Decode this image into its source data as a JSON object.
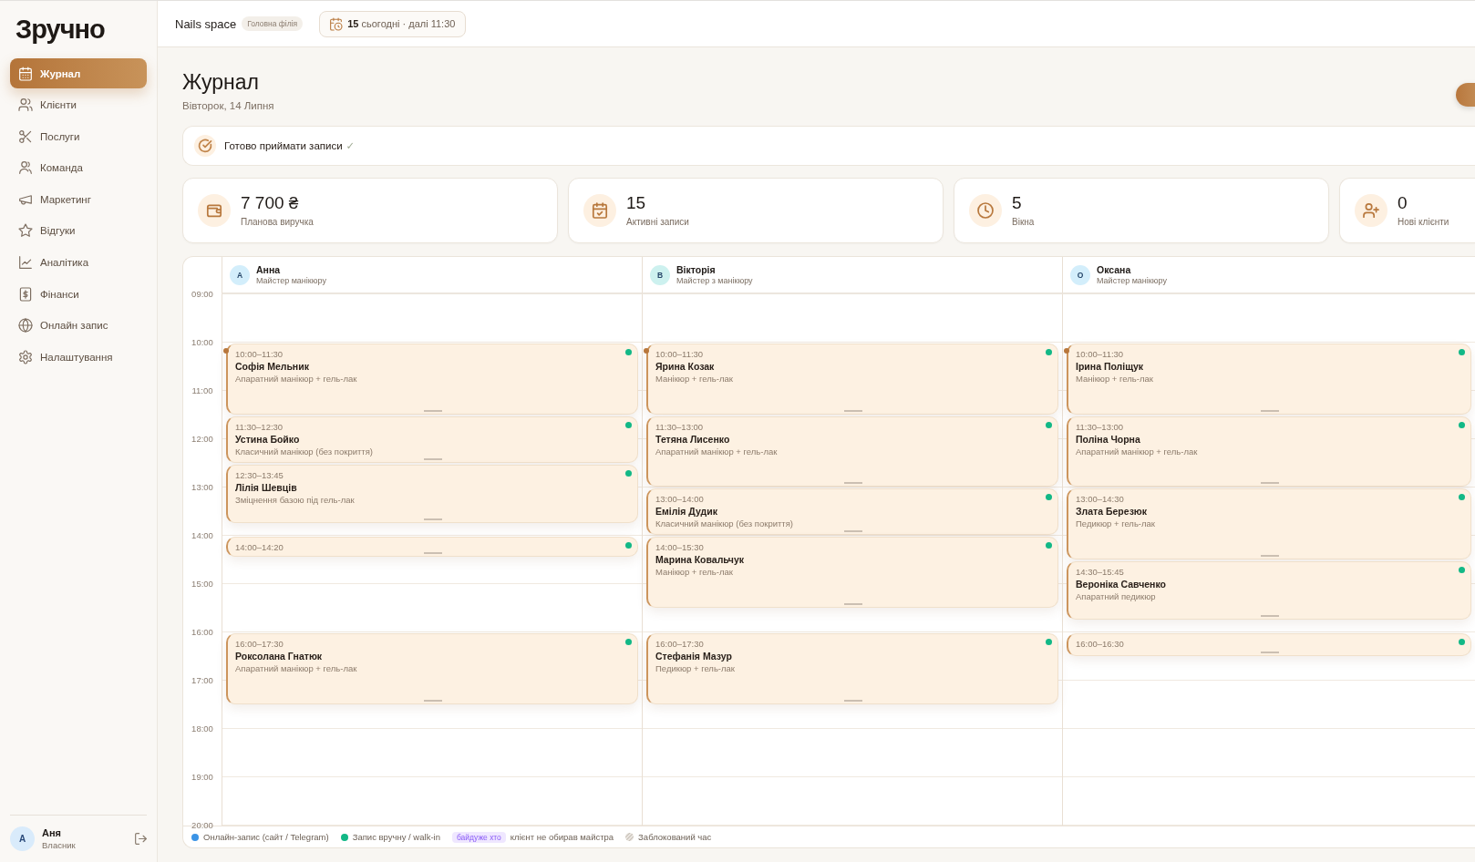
{
  "sidebar": {
    "logo": "Зручно",
    "nav": [
      {
        "label": "Журнал",
        "selected": true
      },
      {
        "label": "Клієнти",
        "selected": false
      },
      {
        "label": "Послуги",
        "selected": false
      },
      {
        "label": "Команда",
        "selected": false
      },
      {
        "label": "Маркетинг",
        "selected": false
      },
      {
        "label": "Відгуки",
        "selected": false
      },
      {
        "label": "Аналітика",
        "selected": false
      },
      {
        "label": "Фінанси",
        "selected": false
      },
      {
        "label": "Онлайн запис",
        "selected": false
      },
      {
        "label": "Налаштування",
        "selected": false
      }
    ],
    "user": {
      "initial": "А",
      "name": "Аня",
      "role": "Власник"
    }
  },
  "topbar": {
    "business": "Nails space",
    "branch": "Головна філія",
    "today": "**15** сьогодні · далі 11:30"
  },
  "page": {
    "title": "Журнал",
    "date": "Вівторок, 14 Липня"
  },
  "status_banner": {
    "label": "Готово приймати записи",
    "check": "✓"
  },
  "stats": [
    {
      "value": "7 700 ₴",
      "label": "Планова виручка"
    },
    {
      "value": "15",
      "label": "Активні записи"
    },
    {
      "value": "5",
      "label": "Вікна"
    },
    {
      "value": "0",
      "label": "Нові клієнти"
    }
  ],
  "calendar": {
    "hours": [
      "09:00",
      "10:00",
      "11:00",
      "12:00",
      "13:00",
      "14:00",
      "15:00",
      "16:00",
      "17:00",
      "18:00",
      "19:00",
      "20:00"
    ],
    "masters": [
      {
        "initial": "А",
        "name": "Анна",
        "role": "Майстер манікюру",
        "color": "#d3eefb",
        "appointments": [
          {
            "time": "10:00–11:30",
            "client": "Софія Мельник",
            "service": "Апаратний манікюр + гель-лак",
            "color": "#12b886"
          },
          {
            "time": "11:30–12:30",
            "client": "Устина Бойко",
            "service": "Класичний манікюр (без покриття)",
            "color": "#12b886"
          },
          {
            "time": "12:30–13:45",
            "client": "Лілія Шевців",
            "service": "Зміцнення базою під гель-лак",
            "color": "#12b886"
          },
          {
            "time": "14:00–14:20",
            "color": "#12b886"
          },
          {
            "time": "16:00–17:30",
            "client": "Роксолана Гнатюк",
            "service": "Апаратний манікюр + гель-лак",
            "color": "#12b886"
          }
        ]
      },
      {
        "initial": "В",
        "name": "Вікторія",
        "role": "Майстер з манікюру",
        "color": "#cdf1ef",
        "appointments": [
          {
            "time": "10:00–11:30",
            "client": "Ярина Козак",
            "service": "Манікюр + гель-лак",
            "color": "#12b886"
          },
          {
            "time": "11:30–13:00",
            "client": "Тетяна Лисенко",
            "service": "Апаратний манікюр + гель-лак",
            "color": "#12b886"
          },
          {
            "time": "13:00–14:00",
            "client": "Емілія Дудик",
            "service": "Класичний манікюр (без покриття)",
            "color": "#12b886"
          },
          {
            "time": "14:00–15:30",
            "client": "Марина Ковальчук",
            "service": "Манікюр + гель-лак",
            "color": "#12b886"
          },
          {
            "time": "16:00–17:30",
            "client": "Стефанія Мазур",
            "service": "Педикюр + гель-лак",
            "color": "#12b886"
          }
        ]
      },
      {
        "initial": "О",
        "name": "Оксана",
        "role": "Майстер манікюру",
        "color": "#d3eefb",
        "appointments": [
          {
            "time": "10:00–11:30",
            "client": "Ірина Поліщук",
            "service": "Манікюр + гель-лак",
            "color": "#12b886"
          },
          {
            "time": "11:30–13:00",
            "client": "Поліна Чорна",
            "service": "Апаратний манікюр + гель-лак",
            "color": "#12b886"
          },
          {
            "time": "13:00–14:30",
            "client": "Злата Березюк",
            "service": "Педикюр + гель-лак",
            "color": "#12b886"
          },
          {
            "time": "14:30–15:45",
            "client": "Вероніка Савченко",
            "service": "Апаратний педикюр",
            "color": "#12b886"
          },
          {
            "time": "16:00–16:30",
            "color": "#12b886"
          }
        ]
      }
    ]
  },
  "legend": [
    {
      "kind": "dot",
      "color": "#3b94e6",
      "label": "Онлайн-запис (сайт / Telegram)"
    },
    {
      "kind": "dot",
      "color": "#12b886",
      "label": "Запис вручну / walk-in"
    },
    {
      "kind": "badge",
      "badge": "байдуже хто",
      "label": "клієнт не обирав майстра"
    },
    {
      "kind": "blocked",
      "label": "Заблокований час"
    }
  ]
}
